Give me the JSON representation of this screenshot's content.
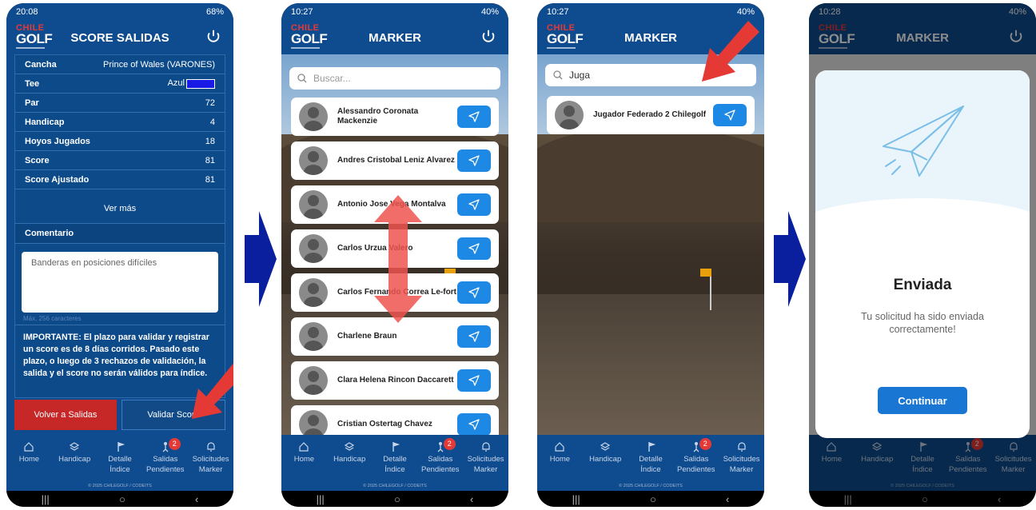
{
  "status": {
    "p1_time": "20:08",
    "p1_right": "68%",
    "p2_time": "10:27",
    "p2_right": "40%",
    "p3_time": "10:27",
    "p3_right": "40%",
    "p4_time": "10:28",
    "p4_right": "40%"
  },
  "logo": {
    "line1": "CHILE",
    "line2": "GOLF"
  },
  "screen1": {
    "title": "SCORE SALIDAS",
    "rows": [
      {
        "k": "Cancha",
        "v": "Prince of Wales (VARONES)"
      },
      {
        "k": "Tee",
        "v": "Azul"
      },
      {
        "k": "Par",
        "v": "72"
      },
      {
        "k": "Handicap",
        "v": "4"
      },
      {
        "k": "Hoyos Jugados",
        "v": "18"
      },
      {
        "k": "Score",
        "v": "81"
      },
      {
        "k": "Score Ajustado",
        "v": "81"
      }
    ],
    "ver_mas": "Ver más",
    "comentario_label": "Comentario",
    "comentario_value": "Banderas en posiciones difíciles",
    "max_chars": "Máx. 256 caracteres",
    "important": "IMPORTANTE: El plazo para validar y registrar un score es de 8 días corridos. Pasado este plazo, o luego de 3 rechazos de validación, la salida y el score no serán válidos para índice.",
    "btn_back": "Volver a Salidas",
    "btn_validate": "Validar Score"
  },
  "screen2": {
    "title": "MARKER",
    "search_placeholder": "Buscar...",
    "players": [
      "Alessandro Coronata Mackenzie",
      "Andres Cristobal Leniz Alvarez",
      "Antonio Jose Vega Montalva",
      "Carlos Urzua Valero",
      "Carlos Fernando Correa Le-fort",
      "Charlene Braun",
      "Clara Helena Rincon Daccarett",
      "Cristian Ostertag Chavez"
    ]
  },
  "screen3": {
    "title": "MARKER",
    "search_value": "Juga",
    "players": [
      "Jugador Federado 2 Chilegolf"
    ]
  },
  "screen4": {
    "title": "MARKER",
    "modal_title": "Enviada",
    "modal_text": "Tu solicitud ha sido enviada correctamente!",
    "modal_button": "Continuar"
  },
  "nav": {
    "items": [
      {
        "l1": "Home",
        "l2": ""
      },
      {
        "l1": "Handicap",
        "l2": ""
      },
      {
        "l1": "Detalle",
        "l2": "Índice"
      },
      {
        "l1": "Salidas",
        "l2": "Pendientes"
      },
      {
        "l1": "Solicitudes",
        "l2": "Marker"
      }
    ],
    "badge": "2",
    "copyright": "© 2025 CHILEGOLF / CODEITS"
  },
  "colors": {
    "brand": "#0f4c8f",
    "accent": "#1e88e5",
    "danger": "#c62828",
    "arrow": "#e53935",
    "transition_arrow": "#0a1f9e"
  }
}
